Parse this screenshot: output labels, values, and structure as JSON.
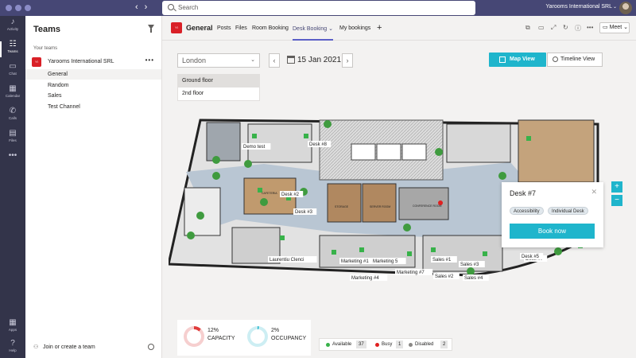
{
  "search": {
    "placeholder": "Search"
  },
  "topbar": {
    "org": "Yarooms International SRL"
  },
  "rail": [
    {
      "label": "Activity",
      "icon": "bell-icon",
      "glyph": "♪"
    },
    {
      "label": "Teams",
      "icon": "teams-icon",
      "glyph": "☷",
      "active": true
    },
    {
      "label": "Chat",
      "icon": "chat-icon",
      "glyph": "▭"
    },
    {
      "label": "Calendar",
      "icon": "calendar-icon",
      "glyph": "▦"
    },
    {
      "label": "Calls",
      "icon": "phone-icon",
      "glyph": "✆"
    },
    {
      "label": "Files",
      "icon": "file-icon",
      "glyph": "▤"
    },
    {
      "label": "",
      "icon": "more-icon",
      "glyph": "•••"
    },
    {
      "label": "Apps",
      "icon": "apps-icon",
      "glyph": "▦"
    },
    {
      "label": "Help",
      "icon": "help-icon",
      "glyph": "?"
    }
  ],
  "teams_panel": {
    "title": "Teams",
    "section": "Your teams",
    "team": {
      "name": "Yarooms International SRL",
      "logo": "YI"
    },
    "channels": [
      "General",
      "Random",
      "Sales",
      "Test Channel"
    ],
    "active_channel": "General",
    "create_label": "Join or create a team"
  },
  "header": {
    "channel": "General",
    "logo": "YI",
    "tabs": [
      "Posts",
      "Files",
      "Room Booking",
      "Desk Booking",
      "My bookings"
    ],
    "active_tab": "Desk Booking",
    "add_tab": "+",
    "meet": "Meet"
  },
  "booking": {
    "location": "London",
    "floors": [
      "Ground floor",
      "2nd floor"
    ],
    "active_floor": "Ground floor",
    "date": "15 Jan 2021",
    "view_map": "Map View",
    "view_timeline": "Timeline View"
  },
  "map_labels": [
    "Demo test",
    "Desk #8",
    "Desk #2",
    "Desk #3",
    "Desk #7",
    "Laurentiu Clenci",
    "Marketing #1",
    "Marketing 5",
    "Marketing #7",
    "Marketing #4",
    "Sales #1",
    "Sales #3",
    "Sales #2",
    "Sales #4",
    "Desk #5",
    "STORAGE",
    "SERVER ROOM",
    "CONFERENCE ROOM",
    "CAFETERIA"
  ],
  "desk_card": {
    "title": "Desk #7",
    "tags": [
      "Accessibility",
      "Individual Desk"
    ],
    "book": "Book now"
  },
  "zoom": {
    "in": "+",
    "out": "−"
  },
  "stats": {
    "capacity": {
      "value": 12,
      "pct": "12%",
      "label": "CAPACITY",
      "color": "#e03b3b"
    },
    "occupancy": {
      "value": 2,
      "pct": "2%",
      "label": "OCCUPANCY",
      "color": "#1fb5cc"
    }
  },
  "legend": [
    {
      "label": "Available",
      "count": "37",
      "color": "#38b24a"
    },
    {
      "label": "Busy",
      "count": "1",
      "color": "#e02020"
    },
    {
      "label": "Disabled",
      "count": "2",
      "color": "#8a8886"
    }
  ],
  "colors": {
    "accent": "#1fb5cc",
    "brand": "#464775",
    "logo": "#d92027"
  }
}
